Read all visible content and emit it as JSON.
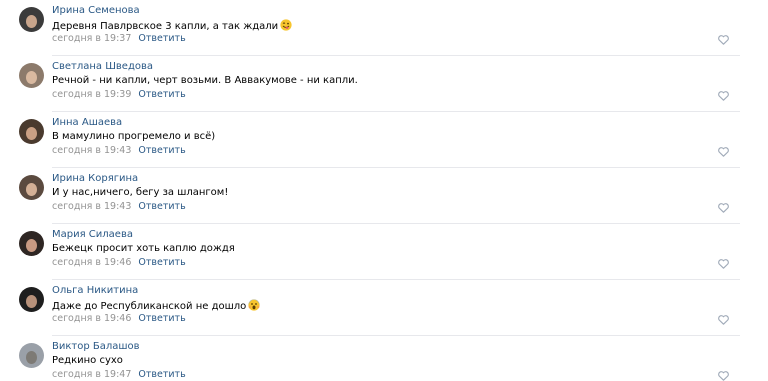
{
  "comments": [
    {
      "author": "Ирина Семенова",
      "text": "Деревня Павлрвское 3 капли, а так ждали",
      "time": "сегодня в 19:37",
      "reply": "Ответить",
      "emoji": "winking-tongue-emoji",
      "avatar_colors": {
        "bg": "#3b3b3b",
        "face": "#c8a58c"
      }
    },
    {
      "author": "Светлана Шведова",
      "text": "Речной - ни капли, черт возьми. В Аввакумове - ни капли.",
      "time": "сегодня в 19:39",
      "reply": "Ответить",
      "emoji": "",
      "avatar_colors": {
        "bg": "#8c7a6b",
        "face": "#d9b9a0"
      }
    },
    {
      "author": "Инна Ашаева",
      "text": "В мамулино прогремело и всё)",
      "time": "сегодня в 19:43",
      "reply": "Ответить",
      "emoji": "",
      "avatar_colors": {
        "bg": "#4a3a2e",
        "face": "#caa084"
      }
    },
    {
      "author": "Ирина Корягина",
      "text": "И у нас,ничего, бегу за шлангом!",
      "time": "сегодня в 19:43",
      "reply": "Ответить",
      "emoji": "",
      "avatar_colors": {
        "bg": "#5b4a3f",
        "face": "#d4b096"
      }
    },
    {
      "author": "Мария Силаева",
      "text": "Бежецк просит хоть каплю дождя",
      "time": "сегодня в 19:46",
      "reply": "Ответить",
      "emoji": "",
      "avatar_colors": {
        "bg": "#2e2623",
        "face": "#c99a82"
      }
    },
    {
      "author": "Ольга Никитина",
      "text": "Даже до Республиканской не дошло",
      "time": "сегодня в 19:46",
      "reply": "Ответить",
      "emoji": "screaming-face-emoji",
      "avatar_colors": {
        "bg": "#1e1e1e",
        "face": "#b7917a"
      }
    },
    {
      "author": "Виктор Балашов",
      "text": "Редкино сухо",
      "time": "сегодня в 19:47",
      "reply": "Ответить",
      "emoji": "",
      "avatar_colors": {
        "bg": "#9aa0a8",
        "face": "#7d7a75"
      }
    }
  ],
  "colors": {
    "author": "#2a5885",
    "text": "#000000",
    "time": "#939393",
    "reply": "#2a5885",
    "like_icon": "#a0aab8",
    "divider": "#e7e8ec"
  }
}
